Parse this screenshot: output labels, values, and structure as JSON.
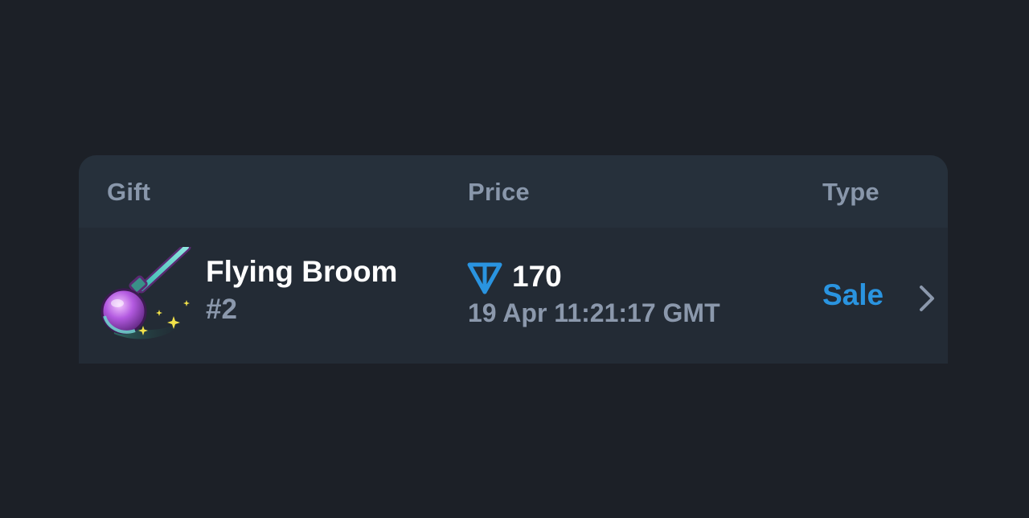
{
  "table": {
    "headers": {
      "gift": "Gift",
      "price": "Price",
      "type": "Type"
    },
    "rows": [
      {
        "gift_name": "Flying Broom",
        "gift_number": "#2",
        "gift_icon": "flying-broom-icon",
        "price_currency_icon": "ton-icon",
        "price": "170",
        "date": "19 Apr 11:21:17 GMT",
        "type": "Sale"
      }
    ]
  },
  "colors": {
    "background": "#1c2027",
    "card": "#232b35",
    "header": "#26303b",
    "accent": "#2a94e0",
    "muted_text": "#8b98ac"
  }
}
